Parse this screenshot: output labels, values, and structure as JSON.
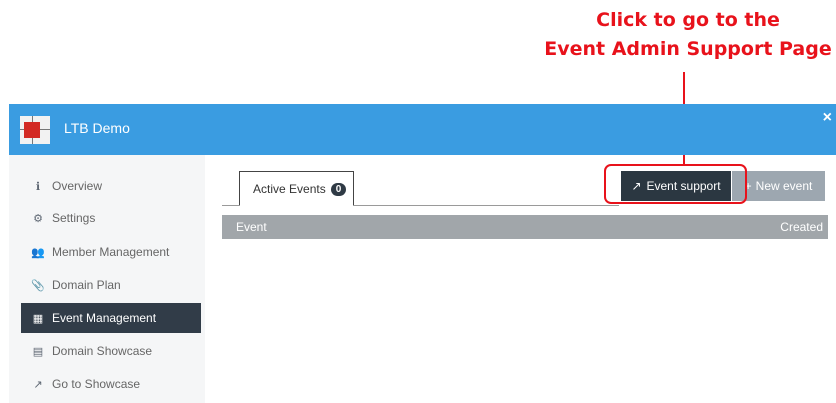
{
  "callout": {
    "line1": "Click to go to the",
    "line2": "Event Admin Support Page",
    "color": "#e8121b"
  },
  "header": {
    "title": "LTB Demo",
    "close_label": "×",
    "color": "#3a9ce1"
  },
  "sidebar": {
    "items": [
      {
        "icon": "info-icon",
        "glyph": "ℹ",
        "label": "Overview"
      },
      {
        "icon": "gear-icon",
        "glyph": "⚙",
        "label": "Settings"
      },
      {
        "icon": "users-icon",
        "glyph": "👥",
        "label": "Member Management"
      },
      {
        "icon": "paperclip-icon",
        "glyph": "📎",
        "label": "Domain Plan"
      },
      {
        "icon": "calendar-icon",
        "glyph": "▦",
        "label": "Event Management",
        "active": true
      },
      {
        "icon": "showcase-icon",
        "glyph": "▤",
        "label": "Domain Showcase"
      },
      {
        "icon": "external-link-icon",
        "glyph": "↗",
        "label": "Go to Showcase"
      }
    ]
  },
  "tabs": [
    {
      "label": "Active Events",
      "count": "0"
    }
  ],
  "toolbar": {
    "event_support_icon": "↗",
    "event_support_label": "Event support",
    "new_event_icon": "+",
    "new_event_label": "New event"
  },
  "table": {
    "columns": [
      "Event",
      "Created"
    ]
  }
}
